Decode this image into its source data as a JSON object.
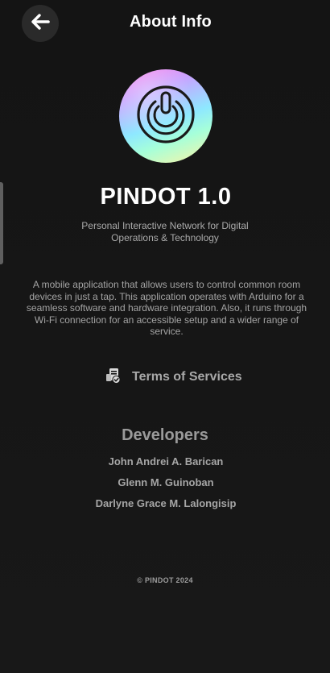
{
  "header": {
    "title": "About Info",
    "back_icon": "arrow-left-icon"
  },
  "app": {
    "logo_icon": "power-icon",
    "name": "PINDOT 1.0",
    "subtitle": "Personal Interactive Network for Digital Operations & Technology",
    "description": "A mobile application that allows users to control common room devices in just a tap. This application operates with Arduino for a seamless software and hardware integration. Also, it runs through Wi-Fi connection for an accessible setup and a wider range of service."
  },
  "terms": {
    "label": "Terms of Services",
    "icon": "document-check-icon"
  },
  "developers": {
    "heading": "Developers",
    "names": [
      "John Andrei A. Barican",
      "Glenn M. Guinoban",
      "Darlyne Grace M. Lalongisip"
    ]
  },
  "footer": {
    "copyright": "© PINDOT 2024"
  },
  "colors": {
    "background": "#151515",
    "text_primary": "#ffffff",
    "text_secondary": "#a6a6a6",
    "back_button_bg": "#2a2a2a",
    "logo_gradient": [
      "#ff7be9",
      "#c8a2ff",
      "#8ee8ff",
      "#a6ffd9",
      "#fff3a3"
    ]
  }
}
